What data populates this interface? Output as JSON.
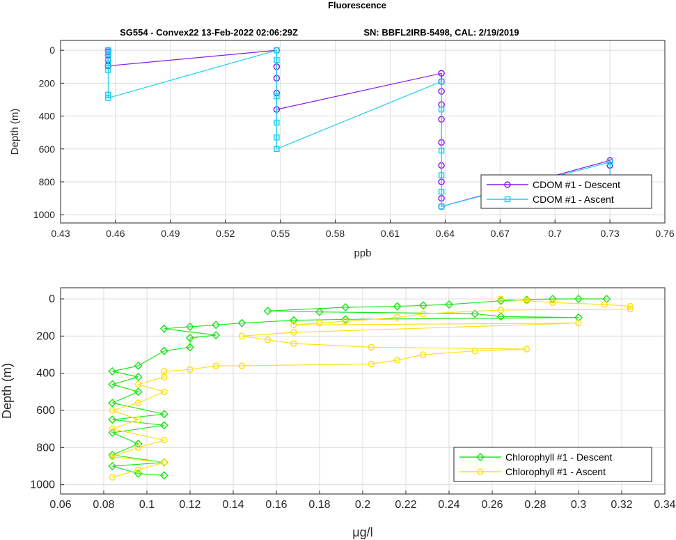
{
  "figure": {
    "title": "Fluorescence",
    "subtitle_left": "SG554 - Convex22 13-Feb-2022 02:06:29Z",
    "subtitle_right": "SN: BBFL2IRB-5498, CAL: 2/19/2019"
  },
  "chart_data": [
    {
      "type": "line",
      "xlabel": "ppb",
      "ylabel": "Depth (m)",
      "xlim": [
        0.43,
        0.76
      ],
      "ylim": [
        1050,
        -60
      ],
      "y_reversed": true,
      "grid": true,
      "legend_position": "bottom-right",
      "x_ticks": [
        "0.43",
        "0.46",
        "0.49",
        "0.52",
        "0.55",
        "0.58",
        "0.61",
        "0.64",
        "0.67",
        "0.7",
        "0.73",
        "0.76"
      ],
      "y_ticks": [
        "0",
        "200",
        "400",
        "600",
        "800",
        "1000"
      ],
      "series": [
        {
          "name": "CDOM #1 - Descent",
          "color": "#8a19f0",
          "marker": "circle",
          "points": [
            [
              0.456,
              0
            ],
            [
              0.456,
              10
            ],
            [
              0.456,
              30
            ],
            [
              0.456,
              60
            ],
            [
              0.456,
              95
            ],
            [
              0.548,
              0
            ],
            [
              0.548,
              100
            ],
            [
              0.548,
              170
            ],
            [
              0.548,
              260
            ],
            [
              0.548,
              360
            ],
            [
              0.638,
              140
            ],
            [
              0.638,
              190
            ],
            [
              0.638,
              250
            ],
            [
              0.638,
              330
            ],
            [
              0.638,
              420
            ],
            [
              0.638,
              560
            ],
            [
              0.638,
              700
            ],
            [
              0.638,
              800
            ],
            [
              0.638,
              900
            ],
            [
              0.638,
              950
            ],
            [
              0.73,
              670
            ],
            [
              0.73,
              700
            ],
            [
              0.73,
              790
            ],
            [
              0.73,
              860
            ],
            [
              0.73,
              920
            ]
          ]
        },
        {
          "name": "CDOM #1 - Ascent",
          "color": "#1ecff0",
          "marker": "square",
          "points": [
            [
              0.456,
              0
            ],
            [
              0.456,
              20
            ],
            [
              0.456,
              50
            ],
            [
              0.456,
              80
            ],
            [
              0.456,
              120
            ],
            [
              0.456,
              270
            ],
            [
              0.456,
              290
            ],
            [
              0.548,
              0
            ],
            [
              0.548,
              60
            ],
            [
              0.548,
              280
            ],
            [
              0.548,
              440
            ],
            [
              0.548,
              530
            ],
            [
              0.548,
              600
            ],
            [
              0.638,
              190
            ],
            [
              0.638,
              360
            ],
            [
              0.638,
              610
            ],
            [
              0.638,
              760
            ],
            [
              0.638,
              860
            ],
            [
              0.638,
              950
            ],
            [
              0.73,
              680
            ],
            [
              0.73,
              800
            ],
            [
              0.73,
              880
            ],
            [
              0.73,
              940
            ]
          ]
        }
      ]
    },
    {
      "type": "line",
      "xlabel": "μg/l",
      "ylabel": "Depth (m)",
      "xlim": [
        0.06,
        0.34
      ],
      "ylim": [
        1050,
        -60
      ],
      "y_reversed": true,
      "grid": true,
      "legend_position": "bottom-right",
      "x_ticks": [
        "0.06",
        "0.08",
        "0.1",
        "0.12",
        "0.14",
        "0.16",
        "0.18",
        "0.2",
        "0.22",
        "0.24",
        "0.26",
        "0.28",
        "0.3",
        "0.32",
        "0.34"
      ],
      "y_ticks": [
        "0",
        "200",
        "400",
        "600",
        "800",
        "1000"
      ],
      "series": [
        {
          "name": "Chlorophyll #1 - Descent",
          "color": "#1ee61e",
          "marker": "diamond",
          "points": [
            [
              0.313,
              0
            ],
            [
              0.3,
              0
            ],
            [
              0.288,
              0
            ],
            [
              0.276,
              5
            ],
            [
              0.264,
              10
            ],
            [
              0.24,
              30
            ],
            [
              0.228,
              35
            ],
            [
              0.216,
              40
            ],
            [
              0.192,
              45
            ],
            [
              0.156,
              65
            ],
            [
              0.18,
              70
            ],
            [
              0.252,
              80
            ],
            [
              0.264,
              95
            ],
            [
              0.3,
              100
            ],
            [
              0.192,
              110
            ],
            [
              0.168,
              115
            ],
            [
              0.144,
              130
            ],
            [
              0.132,
              140
            ],
            [
              0.12,
              150
            ],
            [
              0.108,
              160
            ],
            [
              0.132,
              195
            ],
            [
              0.12,
              210
            ],
            [
              0.12,
              260
            ],
            [
              0.108,
              280
            ],
            [
              0.096,
              360
            ],
            [
              0.084,
              390
            ],
            [
              0.096,
              420
            ],
            [
              0.084,
              460
            ],
            [
              0.096,
              500
            ],
            [
              0.084,
              560
            ],
            [
              0.108,
              620
            ],
            [
              0.084,
              650
            ],
            [
              0.108,
              680
            ],
            [
              0.084,
              720
            ],
            [
              0.096,
              780
            ],
            [
              0.084,
              840
            ],
            [
              0.108,
              880
            ],
            [
              0.084,
              900
            ],
            [
              0.096,
              940
            ],
            [
              0.108,
              950
            ]
          ]
        },
        {
          "name": "Chlorophyll #1 - Ascent",
          "color": "#ffe014",
          "marker": "circle",
          "points": [
            [
              0.264,
              0
            ],
            [
              0.276,
              10
            ],
            [
              0.288,
              20
            ],
            [
              0.312,
              30
            ],
            [
              0.324,
              40
            ],
            [
              0.324,
              55
            ],
            [
              0.264,
              60
            ],
            [
              0.228,
              80
            ],
            [
              0.216,
              100
            ],
            [
              0.192,
              120
            ],
            [
              0.18,
              130
            ],
            [
              0.168,
              140
            ],
            [
              0.3,
              130
            ],
            [
              0.168,
              180
            ],
            [
              0.144,
              200
            ],
            [
              0.156,
              220
            ],
            [
              0.168,
              240
            ],
            [
              0.204,
              260
            ],
            [
              0.276,
              270
            ],
            [
              0.252,
              280
            ],
            [
              0.228,
              300
            ],
            [
              0.216,
              330
            ],
            [
              0.204,
              350
            ],
            [
              0.144,
              360
            ],
            [
              0.132,
              360
            ],
            [
              0.12,
              380
            ],
            [
              0.108,
              390
            ],
            [
              0.108,
              420
            ],
            [
              0.096,
              460
            ],
            [
              0.108,
              500
            ],
            [
              0.096,
              560
            ],
            [
              0.084,
              600
            ],
            [
              0.096,
              650
            ],
            [
              0.084,
              700
            ],
            [
              0.108,
              760
            ],
            [
              0.096,
              800
            ],
            [
              0.084,
              850
            ],
            [
              0.108,
              880
            ],
            [
              0.096,
              920
            ],
            [
              0.084,
              960
            ]
          ]
        }
      ]
    }
  ]
}
